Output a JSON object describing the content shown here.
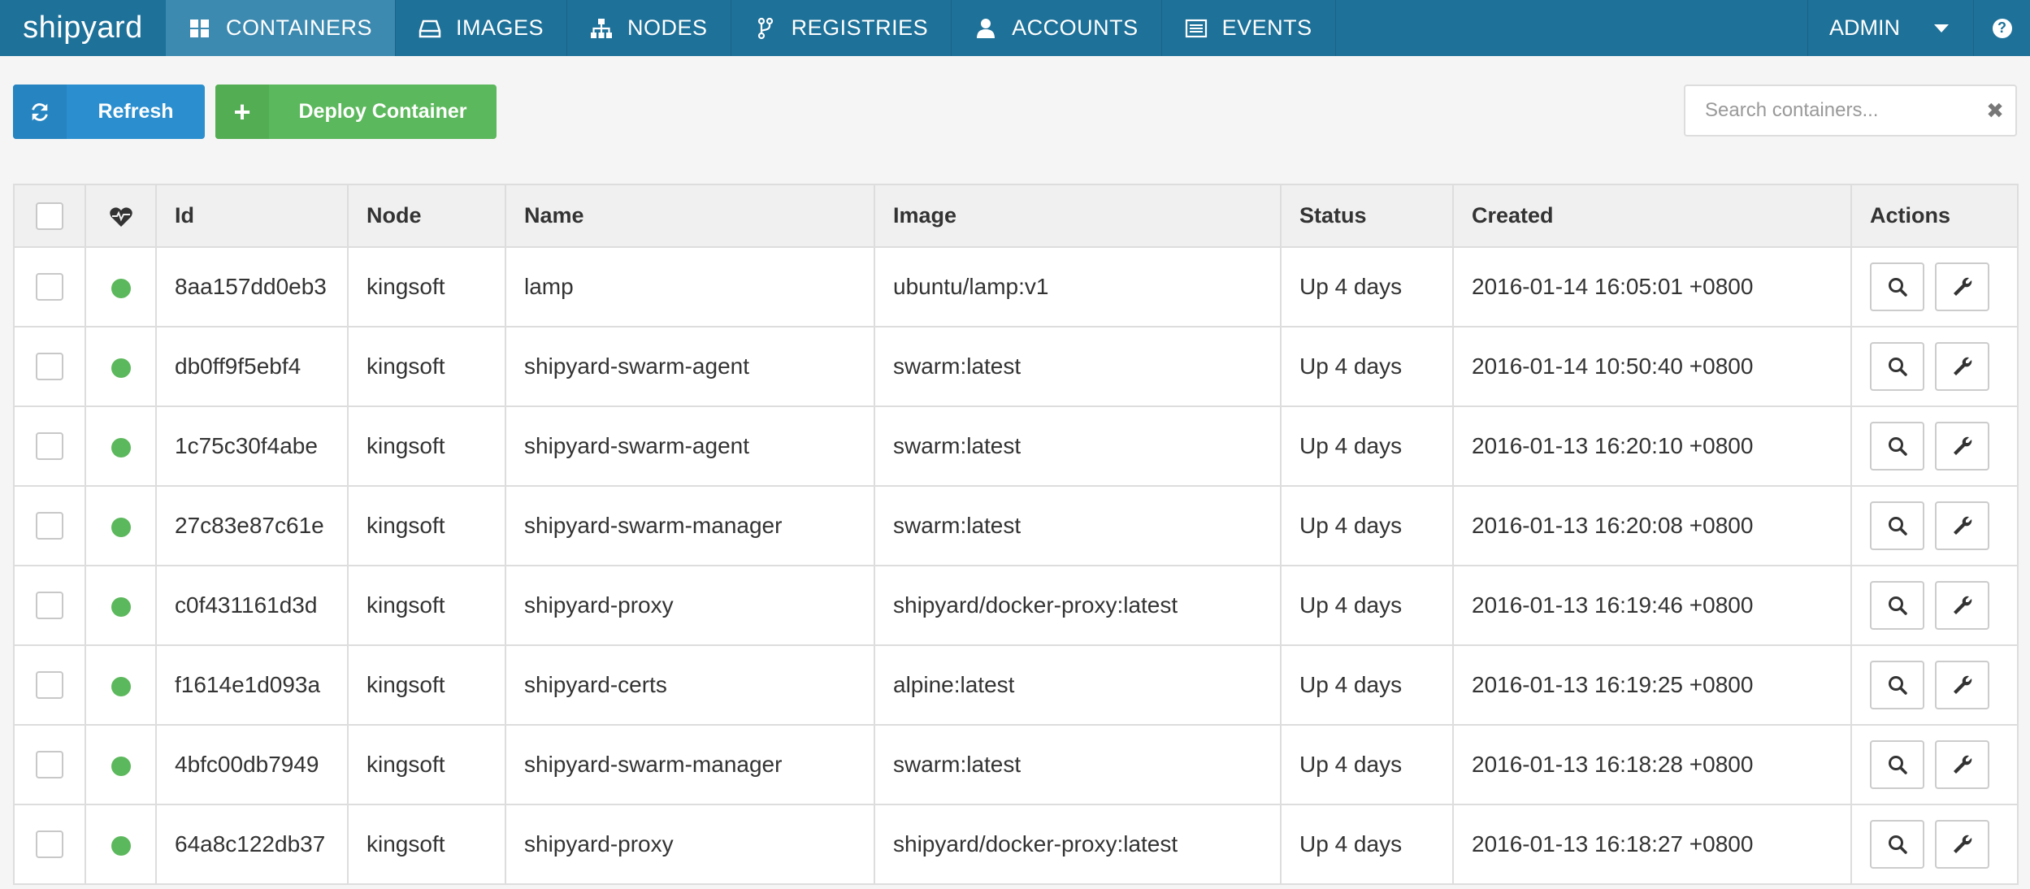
{
  "app": {
    "brand": "shipyard"
  },
  "nav": {
    "items": [
      {
        "label": "CONTAINERS",
        "icon": "th-large-icon",
        "active": true
      },
      {
        "label": "IMAGES",
        "icon": "hdd-icon",
        "active": false
      },
      {
        "label": "NODES",
        "icon": "sitemap-icon",
        "active": false
      },
      {
        "label": "REGISTRIES",
        "icon": "code-fork-icon",
        "active": false
      },
      {
        "label": "ACCOUNTS",
        "icon": "user-icon",
        "active": false
      },
      {
        "label": "EVENTS",
        "icon": "list-alt-icon",
        "active": false
      }
    ],
    "user": "ADMIN",
    "help": "?"
  },
  "toolbar": {
    "refresh_label": "Refresh",
    "deploy_label": "Deploy Container",
    "search_placeholder": "Search containers...",
    "search_value": ""
  },
  "table": {
    "headers": {
      "id": "Id",
      "node": "Node",
      "name": "Name",
      "image": "Image",
      "status": "Status",
      "created": "Created",
      "actions": "Actions"
    },
    "rows": [
      {
        "id": "8aa157dd0eb3",
        "node": "kingsoft",
        "name": "lamp",
        "image": "ubuntu/lamp:v1",
        "status": "Up 4 days",
        "created": "2016-01-14 16:05:01 +0800"
      },
      {
        "id": "db0ff9f5ebf4",
        "node": "kingsoft",
        "name": "shipyard-swarm-agent",
        "image": "swarm:latest",
        "status": "Up 4 days",
        "created": "2016-01-14 10:50:40 +0800"
      },
      {
        "id": "1c75c30f4abe",
        "node": "kingsoft",
        "name": "shipyard-swarm-agent",
        "image": "swarm:latest",
        "status": "Up 4 days",
        "created": "2016-01-13 16:20:10 +0800"
      },
      {
        "id": "27c83e87c61e",
        "node": "kingsoft",
        "name": "shipyard-swarm-manager",
        "image": "swarm:latest",
        "status": "Up 4 days",
        "created": "2016-01-13 16:20:08 +0800"
      },
      {
        "id": "c0f431161d3d",
        "node": "kingsoft",
        "name": "shipyard-proxy",
        "image": "shipyard/docker-proxy:latest",
        "status": "Up 4 days",
        "created": "2016-01-13 16:19:46 +0800"
      },
      {
        "id": "f1614e1d093a",
        "node": "kingsoft",
        "name": "shipyard-certs",
        "image": "alpine:latest",
        "status": "Up 4 days",
        "created": "2016-01-13 16:19:25 +0800"
      },
      {
        "id": "4bfc00db7949",
        "node": "kingsoft",
        "name": "shipyard-swarm-manager",
        "image": "swarm:latest",
        "status": "Up 4 days",
        "created": "2016-01-13 16:18:28 +0800"
      },
      {
        "id": "64a8c122db37",
        "node": "kingsoft",
        "name": "shipyard-proxy",
        "image": "shipyard/docker-proxy:latest",
        "status": "Up 4 days",
        "created": "2016-01-13 16:18:27 +0800"
      }
    ]
  },
  "colors": {
    "navbar": "#1e7199",
    "nav_active": "#3d8ab0",
    "refresh_button": "#2b8fcf",
    "deploy_button": "#5cb85c",
    "health_running": "#5cb85c"
  }
}
